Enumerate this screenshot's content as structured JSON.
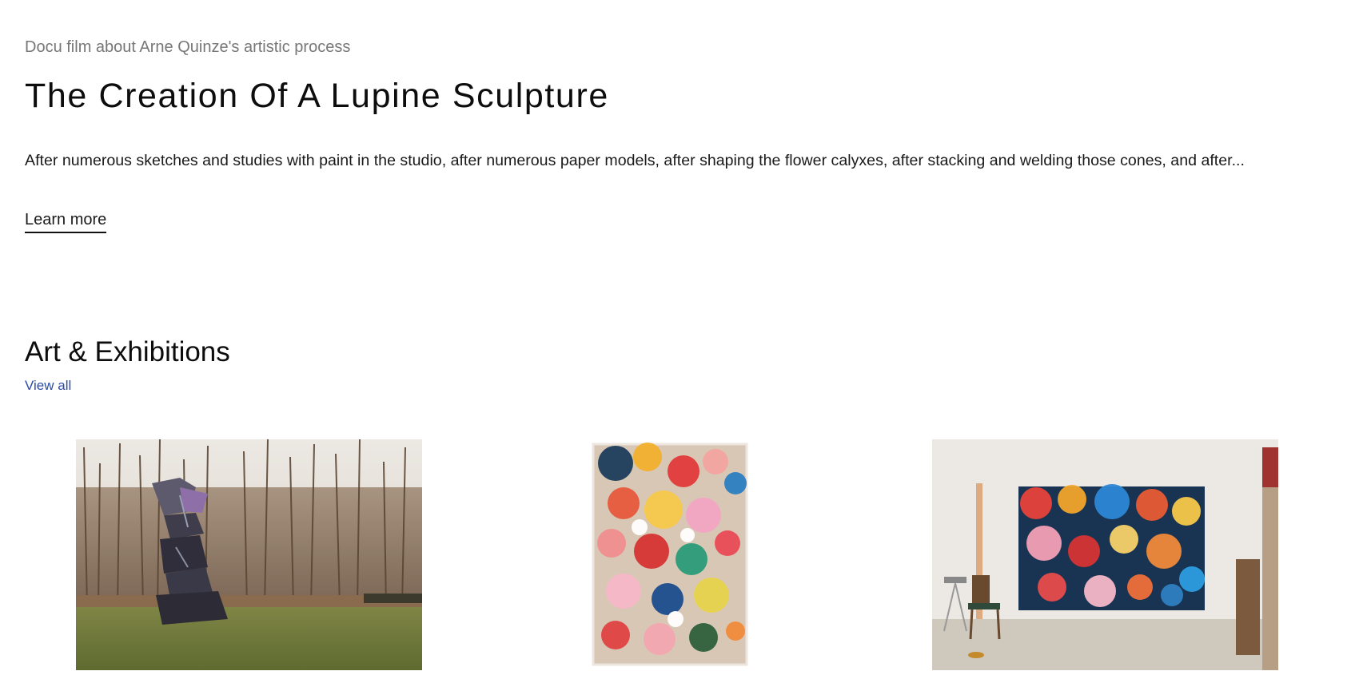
{
  "feature": {
    "eyebrow": "Docu film about Arne Quinze's artistic process",
    "title": "The Creation Of A Lupine Sculpture",
    "description": "After numerous sketches and studies with paint in the studio, after numerous paper models, after shaping the flower calyxes, after stacking and welding those cones, and after...",
    "link_label": "Learn more"
  },
  "section": {
    "title": "Art & Exhibitions",
    "link_label": "View all"
  },
  "cards": [
    {
      "image": "outdoor-sculpture-in-park"
    },
    {
      "image": "floral-abstract-painting"
    },
    {
      "image": "painting-in-artist-studio"
    }
  ]
}
